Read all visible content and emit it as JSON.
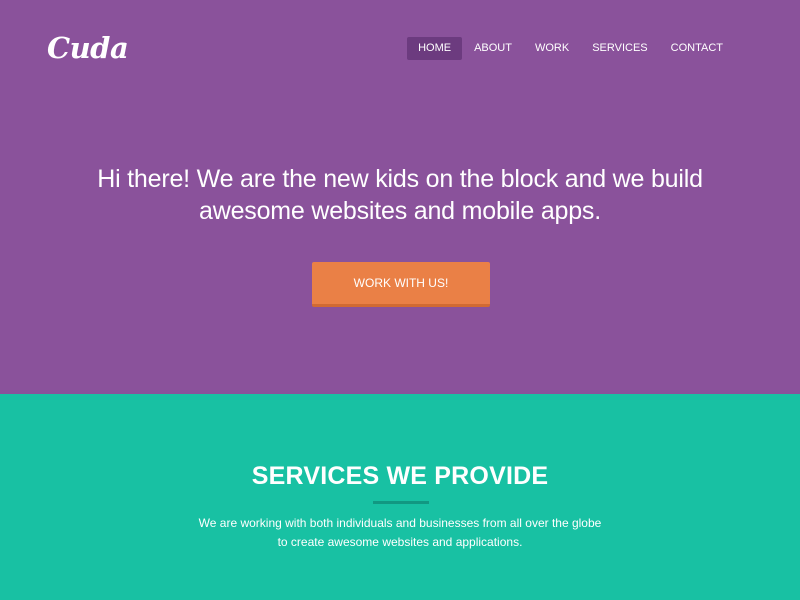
{
  "brand": {
    "logo_text": "Cuda"
  },
  "nav": {
    "items": [
      {
        "label": "HOME",
        "active": true
      },
      {
        "label": "ABOUT",
        "active": false
      },
      {
        "label": "WORK",
        "active": false
      },
      {
        "label": "SERVICES",
        "active": false
      },
      {
        "label": "CONTACT",
        "active": false
      }
    ]
  },
  "hero": {
    "headline": "Hi there! We are the new kids on the block and we build awesome websites and mobile apps.",
    "cta_label": "WORK WITH US!"
  },
  "services": {
    "title": "SERVICES WE PROVIDE",
    "description_line1": "We are working with both individuals and businesses from all over the globe",
    "description_line2": "to create awesome websites and applications."
  },
  "colors": {
    "hero_bg": "#8a529b",
    "nav_active_bg": "#6c3b7f",
    "cta_bg": "#ea8046",
    "services_bg": "#18c1a3",
    "divider": "#119882",
    "text": "#ffffff"
  }
}
